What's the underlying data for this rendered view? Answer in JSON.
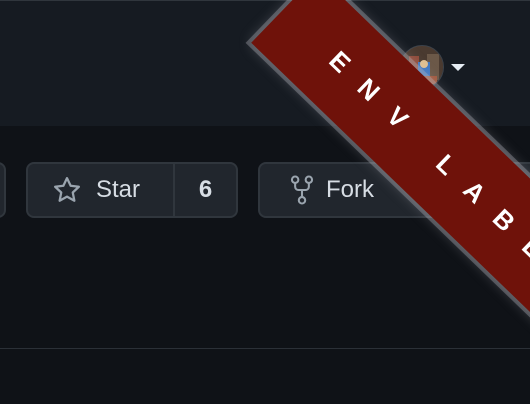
{
  "header": {
    "avatar_alt": "user avatar"
  },
  "repo_actions": {
    "star_label": "Star",
    "star_count": "6",
    "fork_label": "Fork"
  },
  "env_ribbon": {
    "label": "ENV LABEL"
  },
  "colors": {
    "background": "#0f1217",
    "header_background": "#161b22",
    "button_background": "#21262d",
    "button_border": "#30363d",
    "ribbon": "#6f120a",
    "text": "#d7dde4"
  }
}
